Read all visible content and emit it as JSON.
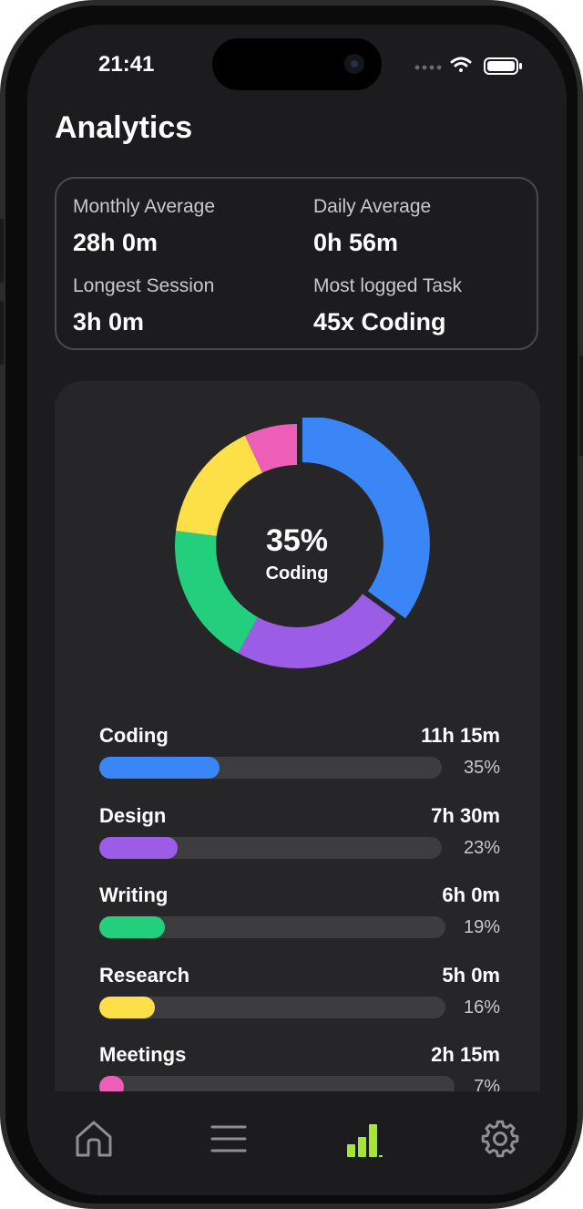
{
  "status": {
    "time": "21:41"
  },
  "page": {
    "title": "Analytics"
  },
  "summary": {
    "monthly_label": "Monthly Average",
    "monthly_value": "28h 0m",
    "daily_label": "Daily Average",
    "daily_value": "0h 56m",
    "longest_label": "Longest Session",
    "longest_value": "3h 0m",
    "most_label": "Most logged Task",
    "most_value": "45x Coding"
  },
  "chart_data": {
    "type": "pie",
    "center_value": "35%",
    "center_label": "Coding",
    "categories": [
      "Coding",
      "Design",
      "Writing",
      "Research",
      "Meetings"
    ],
    "values": [
      35,
      23,
      19,
      16,
      7
    ],
    "colors": [
      "#3a86f7",
      "#9b5de5",
      "#23cf7c",
      "#fde047",
      "#ec5eb8"
    ]
  },
  "tasks": [
    {
      "name": "Coding",
      "time": "11h 15m",
      "pct": "35%",
      "fraction": 0.35,
      "color": "#3a86f7"
    },
    {
      "name": "Design",
      "time": "7h 30m",
      "pct": "23%",
      "fraction": 0.23,
      "color": "#9b5de5"
    },
    {
      "name": "Writing",
      "time": "6h 0m",
      "pct": "19%",
      "fraction": 0.19,
      "color": "#23cf7c"
    },
    {
      "name": "Research",
      "time": "5h 0m",
      "pct": "16%",
      "fraction": 0.16,
      "color": "#fde047"
    },
    {
      "name": "Meetings",
      "time": "2h 15m",
      "pct": "7%",
      "fraction": 0.07,
      "color": "#ec5eb8"
    }
  ],
  "tabbar": {
    "items": [
      {
        "icon": "home-icon"
      },
      {
        "icon": "list-icon"
      },
      {
        "icon": "bar-chart-icon",
        "active": true
      },
      {
        "icon": "gear-icon"
      }
    ],
    "active_color": "#a3e635",
    "inactive_color": "#8e8e93"
  }
}
